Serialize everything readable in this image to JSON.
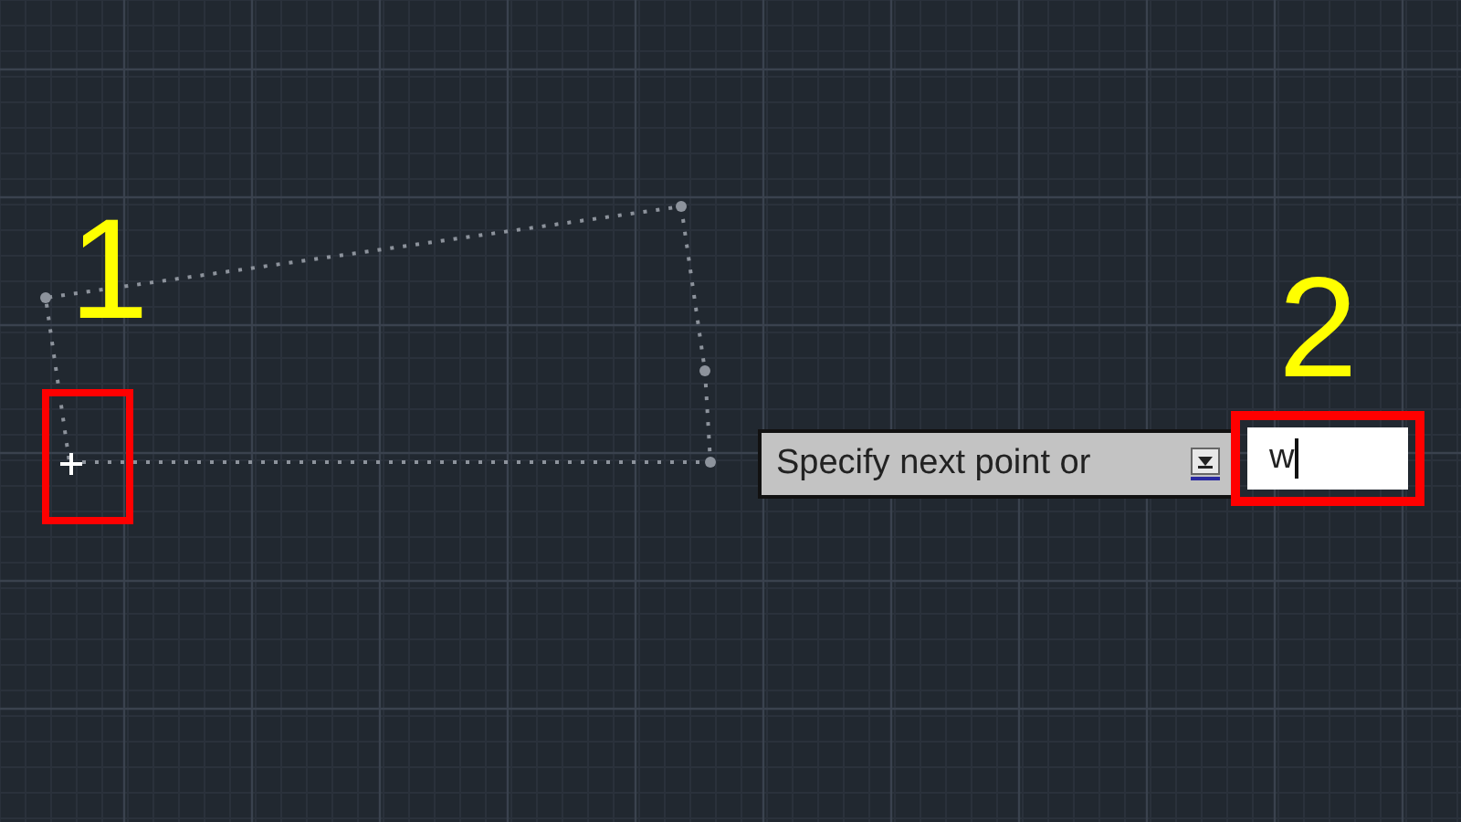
{
  "annotations": [
    {
      "label": "1"
    },
    {
      "label": "2"
    }
  ],
  "tooltip": {
    "prompt": "Specify next point or"
  },
  "command_input": {
    "value": "w"
  }
}
